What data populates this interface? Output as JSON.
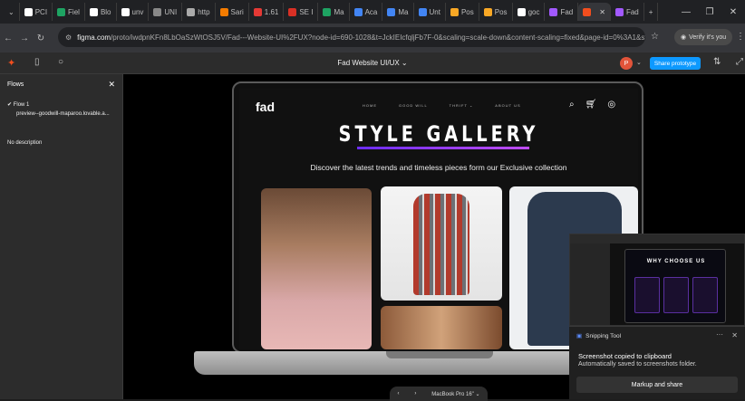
{
  "browser": {
    "tabs": [
      {
        "label": "PCI",
        "color": "#ffffff"
      },
      {
        "label": "Fiel",
        "color": "#1ea362"
      },
      {
        "label": "Blo",
        "color": "#ffffff"
      },
      {
        "label": "unv",
        "color": "#ffffff"
      },
      {
        "label": "UNI",
        "color": "#888888"
      },
      {
        "label": "http",
        "color": "#aaaaaa"
      },
      {
        "label": "Sari",
        "color": "#f57c00"
      },
      {
        "label": "1.61",
        "color": "#e53935"
      },
      {
        "label": "SE I",
        "color": "#d93025"
      },
      {
        "label": "Ma",
        "color": "#1ea362"
      },
      {
        "label": "Aca",
        "color": "#4285f4"
      },
      {
        "label": "Ma",
        "color": "#4285f4"
      },
      {
        "label": "Unt",
        "color": "#4285f4"
      },
      {
        "label": "Pos",
        "color": "#f9a825"
      },
      {
        "label": "Pos",
        "color": "#f9a825"
      },
      {
        "label": "goc",
        "color": "#ffffff"
      },
      {
        "label": "Fad",
        "color": "#a259ff"
      },
      {
        "label": "",
        "color": "#f24e1e"
      },
      {
        "label": "Fad",
        "color": "#a259ff"
      }
    ],
    "url_domain": "figma.com",
    "url_path": "/proto/iwdpnKFn8LbOaSzWtOSJ5V/Fad---Website-UI%2FUX?node-id=690-1028&t=JckIEIcfqljFb7F-0&scaling=scale-down&content-scaling=fixed&page-id=0%3A1&st...",
    "verify_label": "Verify it's you"
  },
  "figma": {
    "title": "Fad Website UI/UX",
    "share_label": "Share prototype",
    "avatar_letter": "P"
  },
  "sidebar": {
    "header": "Flows",
    "flow_label": "Flow 1",
    "flow_url": "preview--goodwill-maparoo.lovable.a...",
    "description": "No description"
  },
  "site": {
    "logo": "fad",
    "nav": [
      "HOME",
      "GOOD WILL",
      "THRIFT",
      "ABOUT US"
    ],
    "title": "STYLE GALLERY",
    "subtitle": "Discover the latest trends and timeless pieces form our Exclusive collection"
  },
  "device": {
    "label": "MacBook Pro 16\""
  },
  "thumbnail": {
    "title": "WHY CHOOSE US"
  },
  "toast": {
    "app": "Snipping Tool",
    "line1": "Screenshot copied to clipboard",
    "line2": "Automatically saved to screenshots folder.",
    "button": "Markup and share"
  }
}
